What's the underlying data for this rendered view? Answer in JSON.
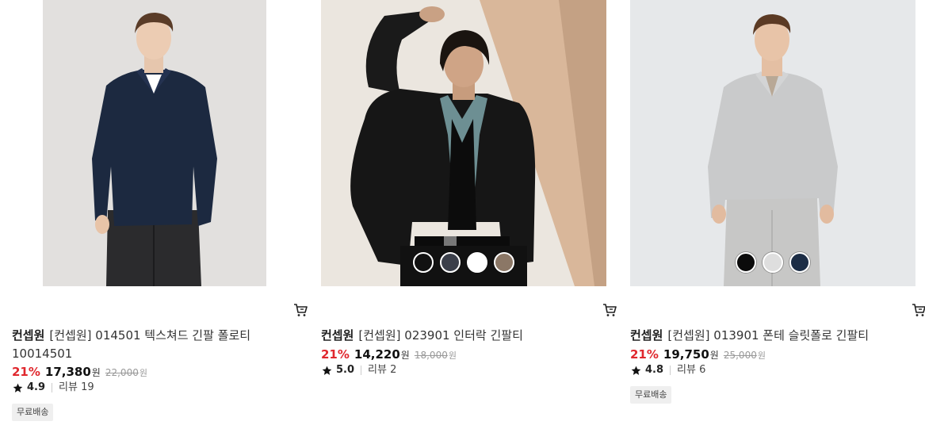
{
  "products": [
    {
      "brand": "컨셉원",
      "name": "[컨셉원] 014501 텍스쳐드 긴팔 폴로티 10014501",
      "discount": "21%",
      "sale_price": "17,380",
      "sale_unit": "원",
      "original_price": "22,000",
      "original_unit": "원",
      "rating": "4.9",
      "review_label": "리뷰 19",
      "badge": "무료배송",
      "swatches": [],
      "image_desc": "model-navy-polo-icon"
    },
    {
      "brand": "컨셉원",
      "name": "[컨셉원] 023901 인터락 긴팔티",
      "discount": "21%",
      "sale_price": "14,220",
      "sale_unit": "원",
      "original_price": "18,000",
      "original_unit": "원",
      "rating": "5.0",
      "review_label": "리뷰 2",
      "badge": "",
      "swatches": [
        "#111111",
        "#3b3f4a",
        "#ffffff",
        "#8b7766"
      ],
      "image_desc": "model-black-jacket-icon"
    },
    {
      "brand": "컨셉원",
      "name": "[컨셉원] 013901 폰테 슬릿폴로 긴팔티",
      "discount": "21%",
      "sale_price": "19,750",
      "sale_unit": "원",
      "original_price": "25,000",
      "original_unit": "원",
      "rating": "4.8",
      "review_label": "리뷰 6",
      "badge": "무료배송",
      "swatches": [
        "#0b0b0b",
        "#dedede",
        "#1c2d45"
      ],
      "image_desc": "model-gray-polo-icon"
    }
  ],
  "colors": {
    "discount": "#e0282e",
    "badge_bg": "#efefef"
  }
}
